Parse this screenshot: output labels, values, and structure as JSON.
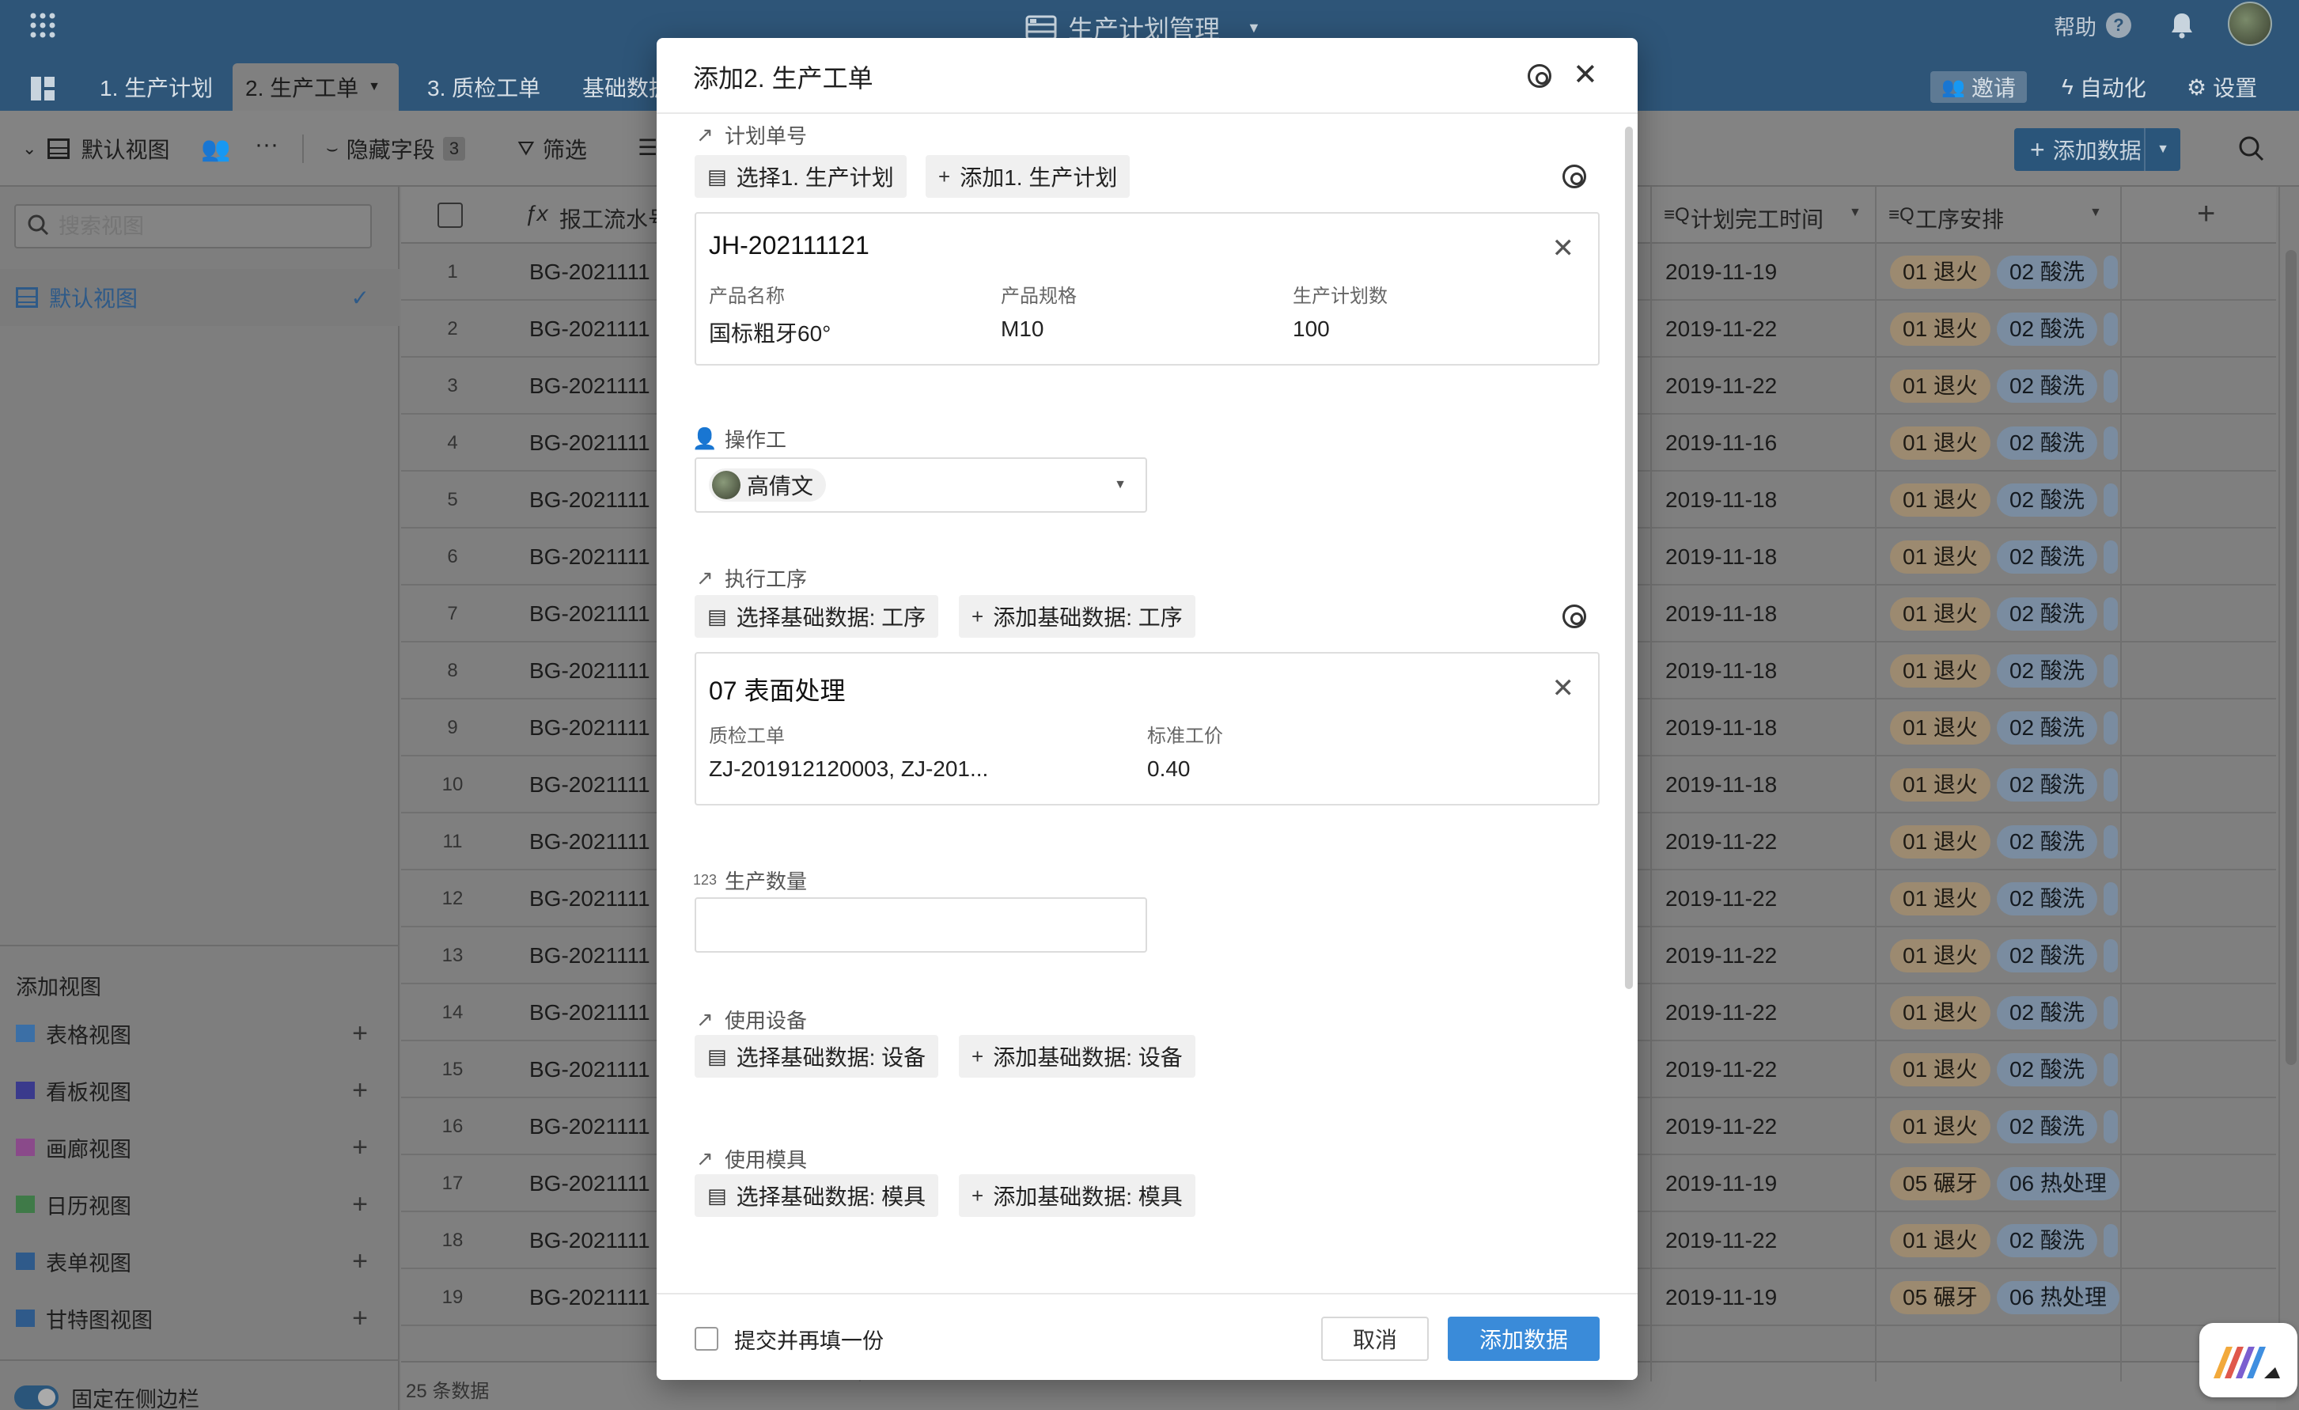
{
  "app": {
    "title": "生产计划管理",
    "help_label": "帮助",
    "help_icon": "question-circle-icon",
    "notification_icon": "bell-icon"
  },
  "tabs": [
    {
      "label": "1. 生产计划"
    },
    {
      "label": "2. 生产工单"
    },
    {
      "label": "3. 质检工单"
    },
    {
      "label": "基础数据"
    }
  ],
  "tabs_right": {
    "invite_label": "邀请",
    "automation_label": "自动化",
    "settings_label": "设置"
  },
  "toolbar": {
    "view_label": "默认视图",
    "more_label": "···",
    "hide_fields_label": "隐藏字段",
    "hide_fields_count": "3",
    "filter_label": "筛选",
    "add_data_label": "添加数据"
  },
  "sidebar": {
    "search_placeholder": "搜索视图",
    "active_view": "默认视图",
    "add_view_title": "添加视图",
    "view_types": [
      {
        "label": "表格视图",
        "color": "#3b6fa6"
      },
      {
        "label": "看板视图",
        "color": "#3a3a8c"
      },
      {
        "label": "画廊视图",
        "color": "#8a4a8a"
      },
      {
        "label": "日历视图",
        "color": "#3f7a48"
      },
      {
        "label": "表单视图",
        "color": "#2f5a8a"
      },
      {
        "label": "甘特图视图",
        "color": "#2f5a8a"
      }
    ],
    "pin_label": "固定在侧边栏"
  },
  "grid": {
    "columns": {
      "serial": "报工流水号",
      "plan_finish": "计划完工时间",
      "process": "工序安排"
    },
    "row_prefix": "BG-2021111",
    "rows": [
      {
        "n": "1",
        "date": "2019-11-19",
        "p1": "01 退火",
        "p2": "02 酸洗",
        "kind": "a"
      },
      {
        "n": "2",
        "date": "2019-11-22",
        "p1": "01 退火",
        "p2": "02 酸洗",
        "kind": "a"
      },
      {
        "n": "3",
        "date": "2019-11-22",
        "p1": "01 退火",
        "p2": "02 酸洗",
        "kind": "a"
      },
      {
        "n": "4",
        "date": "2019-11-16",
        "p1": "01 退火",
        "p2": "02 酸洗",
        "kind": "a"
      },
      {
        "n": "5",
        "date": "2019-11-18",
        "p1": "01 退火",
        "p2": "02 酸洗",
        "kind": "a"
      },
      {
        "n": "6",
        "date": "2019-11-18",
        "p1": "01 退火",
        "p2": "02 酸洗",
        "kind": "a"
      },
      {
        "n": "7",
        "date": "2019-11-18",
        "p1": "01 退火",
        "p2": "02 酸洗",
        "kind": "a"
      },
      {
        "n": "8",
        "date": "2019-11-18",
        "p1": "01 退火",
        "p2": "02 酸洗",
        "kind": "a"
      },
      {
        "n": "9",
        "date": "2019-11-18",
        "p1": "01 退火",
        "p2": "02 酸洗",
        "kind": "a"
      },
      {
        "n": "10",
        "date": "2019-11-18",
        "p1": "01 退火",
        "p2": "02 酸洗",
        "kind": "a"
      },
      {
        "n": "11",
        "date": "2019-11-22",
        "p1": "01 退火",
        "p2": "02 酸洗",
        "kind": "a"
      },
      {
        "n": "12",
        "date": "2019-11-22",
        "p1": "01 退火",
        "p2": "02 酸洗",
        "kind": "a"
      },
      {
        "n": "13",
        "date": "2019-11-22",
        "p1": "01 退火",
        "p2": "02 酸洗",
        "kind": "a"
      },
      {
        "n": "14",
        "date": "2019-11-22",
        "p1": "01 退火",
        "p2": "02 酸洗",
        "kind": "a"
      },
      {
        "n": "15",
        "date": "2019-11-22",
        "p1": "01 退火",
        "p2": "02 酸洗",
        "kind": "a"
      },
      {
        "n": "16",
        "date": "2019-11-22",
        "p1": "01 退火",
        "p2": "02 酸洗",
        "kind": "a"
      },
      {
        "n": "17",
        "date": "2019-11-19",
        "p1": "05 碾牙",
        "p2": "06 热处理",
        "kind": "b"
      },
      {
        "n": "18",
        "date": "2019-11-22",
        "p1": "01 退火",
        "p2": "02 酸洗",
        "kind": "a"
      },
      {
        "n": "19",
        "date": "2019-11-19",
        "p1": "05 碾牙",
        "p2": "06 热处理",
        "kind": "b"
      }
    ],
    "record_count": "25 条数据"
  },
  "modal": {
    "title": "添加2. 生产工单",
    "plan_field": {
      "label": "计划单号",
      "select_label": "选择1. 生产计划",
      "add_label": "添加1. 生产计划",
      "card": {
        "title": "JH-202111121",
        "k1": "产品名称",
        "v1": "国标粗牙60°",
        "k2": "产品规格",
        "v2": "M10",
        "k3": "生产计划数",
        "v3": "100"
      }
    },
    "operator_field": {
      "label": "操作工",
      "value": "高倩文"
    },
    "process_field": {
      "label": "执行工序",
      "select_label": "选择基础数据: 工序",
      "add_label": "添加基础数据: 工序",
      "card": {
        "title": "07 表面处理",
        "k1": "质检工单",
        "v1": "ZJ-201912120003, ZJ-201...",
        "k2": "标准工价",
        "v2": "0.40"
      }
    },
    "quantity_field": {
      "label": "生产数量",
      "value": ""
    },
    "equipment_field": {
      "label": "使用设备",
      "select_label": "选择基础数据: 设备",
      "add_label": "添加基础数据: 设备"
    },
    "mold_field": {
      "label": "使用模具",
      "select_label": "选择基础数据: 模具",
      "add_label": "添加基础数据: 模具"
    },
    "footer": {
      "resubmit_label": "提交并再填一份",
      "cancel_label": "取消",
      "submit_label": "添加数据"
    }
  }
}
